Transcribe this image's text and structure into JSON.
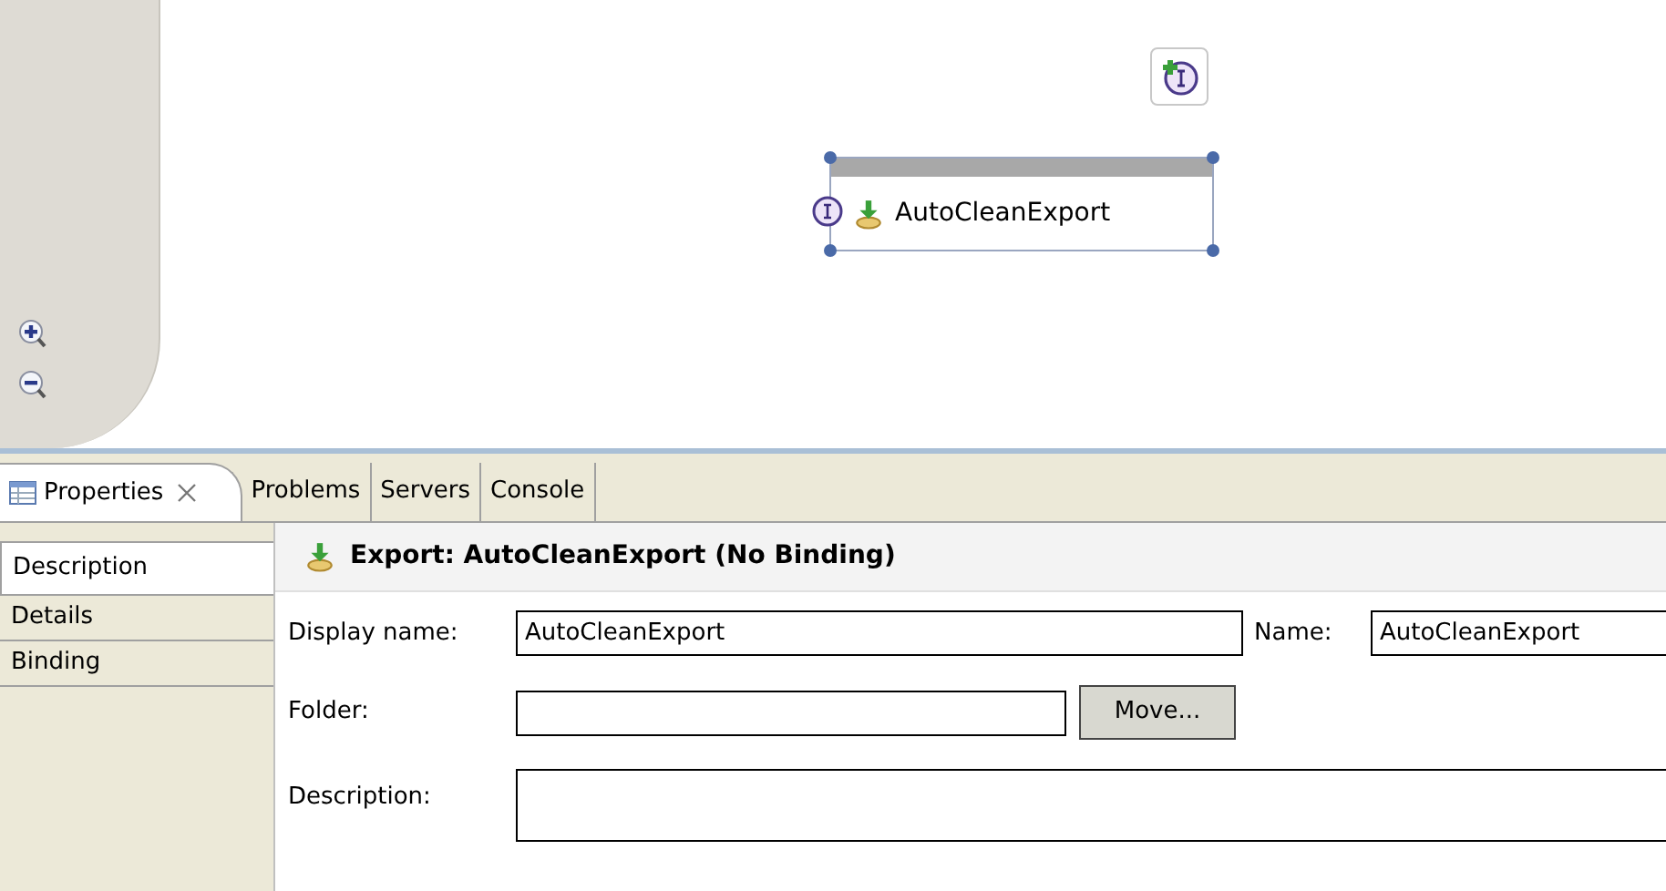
{
  "diagram": {
    "node": {
      "label": "AutoCleanExport",
      "selected": true
    }
  },
  "tabs": [
    {
      "label": "Properties",
      "selected": true,
      "closable": true
    },
    {
      "label": "Problems",
      "selected": false,
      "closable": false
    },
    {
      "label": "Servers",
      "selected": false,
      "closable": false
    },
    {
      "label": "Console",
      "selected": false,
      "closable": false
    }
  ],
  "side_tabs": [
    {
      "label": "Description",
      "selected": true
    },
    {
      "label": "Details",
      "selected": false
    },
    {
      "label": "Binding",
      "selected": false
    }
  ],
  "header": {
    "title": "Export: AutoCleanExport (No Binding)"
  },
  "form": {
    "display_name": {
      "label": "Display name:",
      "value": "AutoCleanExport"
    },
    "name": {
      "label": "Name:",
      "value": "AutoCleanExport"
    },
    "folder": {
      "label": "Folder:"
    },
    "move_button": "Move...",
    "description": {
      "label": "Description:"
    }
  }
}
